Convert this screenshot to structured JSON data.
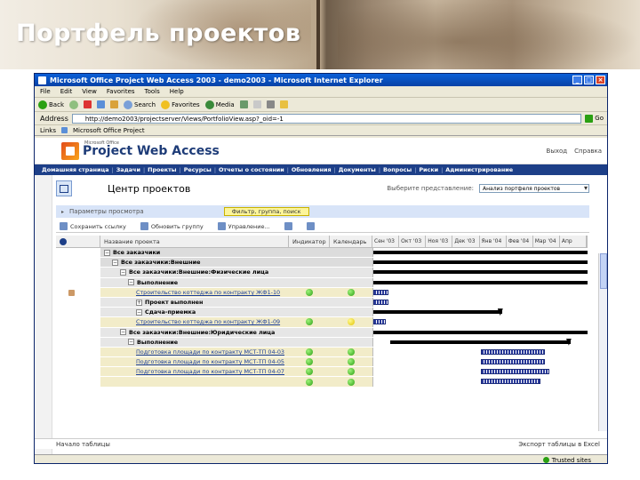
{
  "slide": {
    "title": "Портфель проектов"
  },
  "browser": {
    "title": "Microsoft Office Project Web Access 2003 - demo2003 - Microsoft Internet Explorer",
    "menu": [
      "File",
      "Edit",
      "View",
      "Favorites",
      "Tools",
      "Help"
    ],
    "toolbar": {
      "back": "Back",
      "search": "Search",
      "favorites": "Favorites",
      "media": "Media"
    },
    "address_label": "Address",
    "address_value": "http://demo2003/projectserver/Views/PortfolioView.asp?_oid=-1",
    "go_label": "Go",
    "links_label": "Links",
    "links_item": "Microsoft Office Project",
    "status_zone": "Trusted sites"
  },
  "pwa": {
    "logo_pre": "Microsoft Office",
    "logo_text": "Project Web Access",
    "head_links": [
      "Выход",
      "Справка"
    ],
    "nav": [
      "Домашняя страница",
      "Задачи",
      "Проекты",
      "Ресурсы",
      "Отчеты о состоянии",
      "Обновления",
      "Документы",
      "Вопросы",
      "Риски",
      "Администрирование"
    ],
    "center_title": "Центр проектов",
    "view_label": "Выберите представление:",
    "view_value": "Анализ портфеля проектов",
    "params_label": "Параметры просмотра",
    "params_highlight": "Фильтр, группа, поиск",
    "tools": [
      "Сохранить ссылку",
      "Обновить группу",
      "Управление...",
      "",
      ""
    ],
    "columns": {
      "name": "Название проекта",
      "indicator": "Индикатор",
      "calendar": "Календарь"
    },
    "months": [
      "Сен '03",
      "Окт '03",
      "Ноя '03",
      "Дек '03",
      "Янв '04",
      "Фев '04",
      "Мар '04",
      "Апр"
    ],
    "rows": [
      {
        "label": "Все заказчики",
        "style": "g1",
        "indent": 0,
        "toggle": "−"
      },
      {
        "label": "Все заказчики:Внешние",
        "style": "g1",
        "indent": 1,
        "toggle": "−"
      },
      {
        "label": "Все заказчики:Внешние:Физические лица",
        "style": "g2",
        "indent": 2,
        "toggle": "−"
      },
      {
        "label": "Выполнение",
        "style": "g2",
        "indent": 3,
        "toggle": "−"
      },
      {
        "label": "Строительство коттеджа по контракту ЖФ1-10",
        "style": "pr",
        "indent": 4,
        "link": true,
        "ind": "green",
        "cal": "green"
      },
      {
        "label": "Проект выполнен",
        "style": "g2",
        "indent": 4,
        "toggle": "+"
      },
      {
        "label": "Сдача-приемка",
        "style": "g2",
        "indent": 4,
        "toggle": "−"
      },
      {
        "label": "Строительство коттеджа по контракту ЖФ1-09",
        "style": "pr",
        "indent": 4,
        "link": true,
        "ind": "green",
        "cal": "yellow"
      },
      {
        "label": "Все заказчики:Внешние:Юридические лица",
        "style": "g2",
        "indent": 2,
        "toggle": "−"
      },
      {
        "label": "Выполнение",
        "style": "g2",
        "indent": 3,
        "toggle": "−"
      },
      {
        "label": "Подготовка площади по контракту МСТ-ТП 04-03",
        "style": "pr",
        "indent": 4,
        "link": true,
        "ind": "green",
        "cal": "green"
      },
      {
        "label": "Подготовка площади по контракту МСТ-ТП 04-05",
        "style": "pr",
        "indent": 4,
        "link": true,
        "ind": "green",
        "cal": "green"
      },
      {
        "label": "Подготовка площади по контракту МСТ-ТП 04-07",
        "style": "pr",
        "indent": 4,
        "link": true,
        "ind": "green",
        "cal": "green"
      },
      {
        "label": "",
        "style": "pr",
        "indent": 4,
        "link": true,
        "ind": "green",
        "cal": "green"
      }
    ],
    "footer_left": "Начало таблицы",
    "footer_right": "Экспорт таблицы в Excel"
  }
}
